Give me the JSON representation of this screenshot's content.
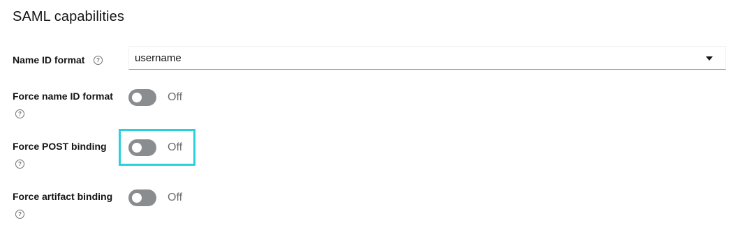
{
  "section": {
    "title": "SAML capabilities"
  },
  "fields": {
    "name_id_format": {
      "label": "Name ID format",
      "help_icon": "help-circle-icon",
      "value": "username"
    },
    "force_name_id_format": {
      "label": "Force name ID format",
      "help_icon": "help-circle-icon",
      "state": "Off"
    },
    "force_post_binding": {
      "label": "Force POST binding",
      "help_icon": "help-circle-icon",
      "state": "Off",
      "highlight_color": "#2bd0dd"
    },
    "force_artifact_binding": {
      "label": "Force artifact binding",
      "help_icon": "help-circle-icon",
      "state": "Off"
    }
  },
  "colors": {
    "toggle_off": "#8a8d90",
    "text_muted": "#6a6e73",
    "text_primary": "#151515"
  }
}
